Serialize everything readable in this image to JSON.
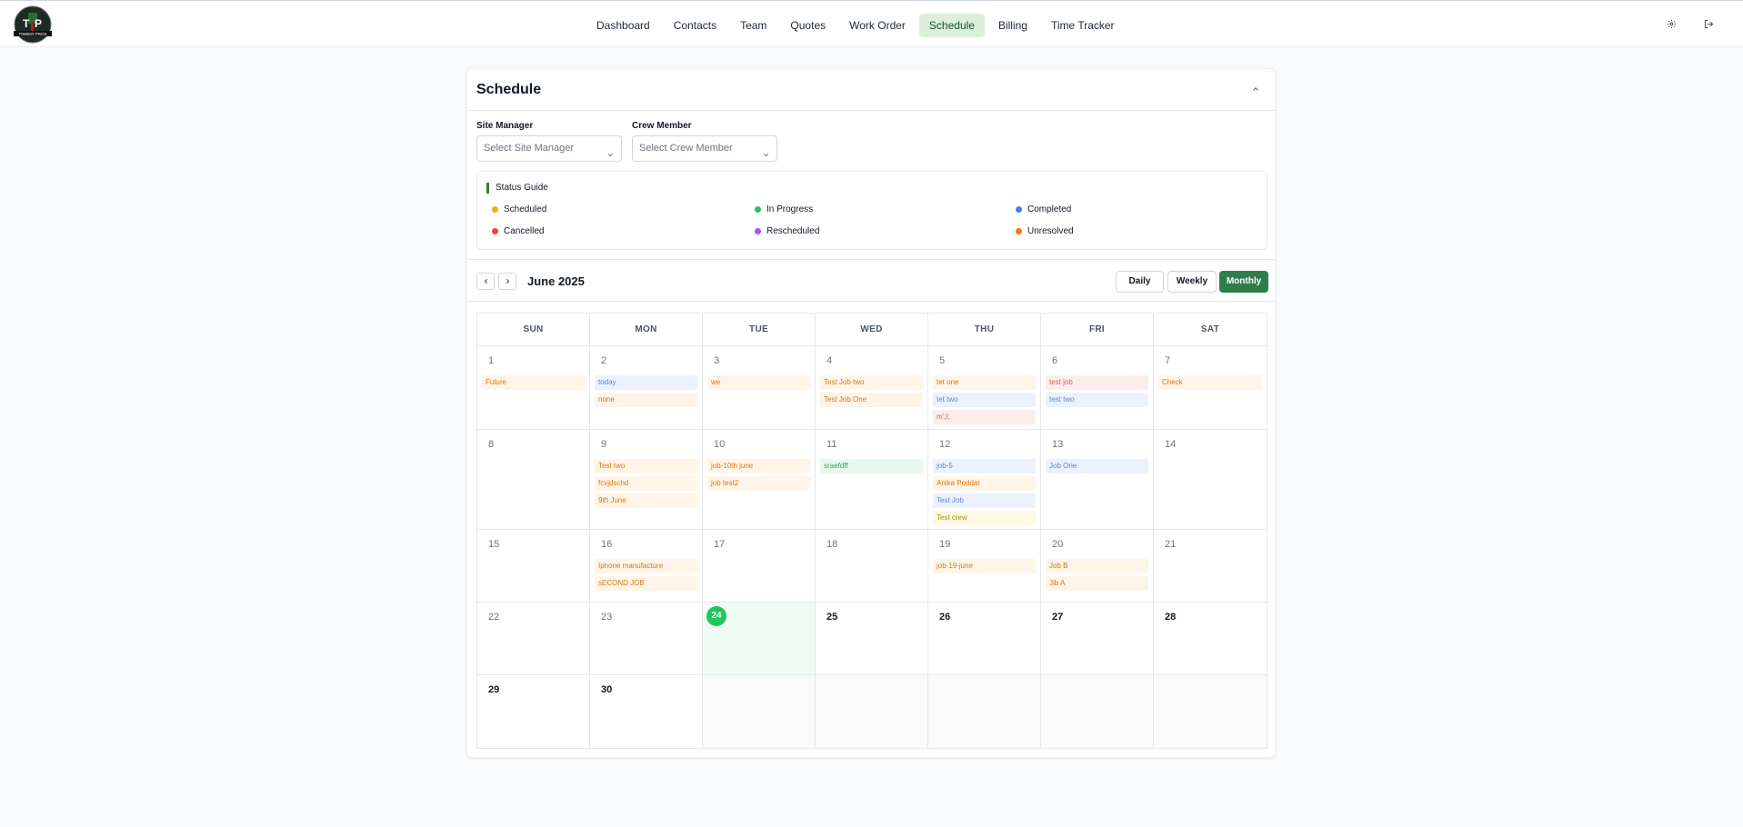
{
  "nav": {
    "logo_text": "TIMBER PROS",
    "items": [
      {
        "label": "Dashboard",
        "active": false
      },
      {
        "label": "Contacts",
        "active": false
      },
      {
        "label": "Team",
        "active": false
      },
      {
        "label": "Quotes",
        "active": false
      },
      {
        "label": "Work Order",
        "active": false
      },
      {
        "label": "Schedule",
        "active": true
      },
      {
        "label": "Billing",
        "active": false
      },
      {
        "label": "Time Tracker",
        "active": false
      }
    ],
    "settings_icon": "gear-icon",
    "logout_icon": "logout-icon"
  },
  "schedule": {
    "title": "Schedule",
    "filters": {
      "site_manager_label": "Site Manager",
      "site_manager_placeholder": "Select Site Manager",
      "crew_member_label": "Crew Member",
      "crew_member_placeholder": "Select Crew Member"
    },
    "status_guide": {
      "title": "Status Guide",
      "statuses": [
        {
          "label": "Scheduled",
          "color": "#eab308"
        },
        {
          "label": "In Progress",
          "color": "#22c55e"
        },
        {
          "label": "Completed",
          "color": "#3b82f6"
        },
        {
          "label": "Cancelled",
          "color": "#ef4444"
        },
        {
          "label": "Rescheduled",
          "color": "#a855f7"
        },
        {
          "label": "Unresolved",
          "color": "#f97316"
        }
      ]
    },
    "month_label": "June 2025",
    "views": {
      "daily": "Daily",
      "weekly": "Weekly",
      "monthly": "Monthly",
      "active": "Monthly"
    },
    "weekdays": [
      "SUN",
      "MON",
      "TUE",
      "WED",
      "THU",
      "FRI",
      "SAT"
    ],
    "today": 24,
    "weeks": [
      [
        {
          "day": "1",
          "events": [
            {
              "title": "Future",
              "color": "orange"
            }
          ]
        },
        {
          "day": "2",
          "events": [
            {
              "title": "today",
              "color": "blue"
            },
            {
              "title": "none",
              "color": "orange"
            }
          ]
        },
        {
          "day": "3",
          "events": [
            {
              "title": "we",
              "color": "orange"
            }
          ]
        },
        {
          "day": "4",
          "events": [
            {
              "title": "Test Job two",
              "color": "orange"
            },
            {
              "title": "Test Job One",
              "color": "orange"
            }
          ]
        },
        {
          "day": "5",
          "events": [
            {
              "title": "tet one",
              "color": "orange"
            },
            {
              "title": "tet two",
              "color": "blue"
            },
            {
              "title": "m';l;",
              "color": "red"
            }
          ]
        },
        {
          "day": "6",
          "events": [
            {
              "title": "test job",
              "color": "red"
            },
            {
              "title": "test two",
              "color": "blue"
            }
          ]
        },
        {
          "day": "7",
          "events": [
            {
              "title": "Check",
              "color": "orange"
            }
          ]
        }
      ],
      [
        {
          "day": "8",
          "events": []
        },
        {
          "day": "9",
          "events": [
            {
              "title": "Test two",
              "color": "orange"
            },
            {
              "title": "fcvjdschd",
              "color": "orange"
            },
            {
              "title": "9th June",
              "color": "orange"
            }
          ]
        },
        {
          "day": "10",
          "events": [
            {
              "title": "job-10th june",
              "color": "orange"
            },
            {
              "title": "job test2",
              "color": "orange"
            }
          ]
        },
        {
          "day": "11",
          "events": [
            {
              "title": "sraefdff",
              "color": "green"
            }
          ]
        },
        {
          "day": "12",
          "events": [
            {
              "title": "job-5",
              "color": "blue"
            },
            {
              "title": "Anika Poddar",
              "color": "orange"
            },
            {
              "title": "Test Job",
              "color": "blue"
            },
            {
              "title": "Test crew",
              "color": "yellow"
            }
          ]
        },
        {
          "day": "13",
          "events": [
            {
              "title": "Job One",
              "color": "blue"
            }
          ]
        },
        {
          "day": "14",
          "events": []
        }
      ],
      [
        {
          "day": "15",
          "events": []
        },
        {
          "day": "16",
          "events": [
            {
              "title": "Iphone manufacture",
              "color": "orange"
            },
            {
              "title": "sECOND JOB",
              "color": "orange"
            }
          ]
        },
        {
          "day": "17",
          "events": []
        },
        {
          "day": "18",
          "events": []
        },
        {
          "day": "19",
          "events": [
            {
              "title": "job-19-june",
              "color": "orange"
            }
          ]
        },
        {
          "day": "20",
          "events": [
            {
              "title": "Job B",
              "color": "orange"
            },
            {
              "title": "Jib A",
              "color": "orange"
            }
          ]
        },
        {
          "day": "21",
          "events": []
        }
      ],
      [
        {
          "day": "22",
          "events": []
        },
        {
          "day": "23",
          "events": []
        },
        {
          "day": "24",
          "events": []
        },
        {
          "day": "25",
          "events": []
        },
        {
          "day": "26",
          "events": []
        },
        {
          "day": "27",
          "events": []
        },
        {
          "day": "28",
          "events": []
        }
      ],
      [
        {
          "day": "29",
          "events": []
        },
        {
          "day": "30",
          "events": []
        },
        {
          "day": "",
          "events": []
        },
        {
          "day": "",
          "events": []
        },
        {
          "day": "",
          "events": []
        },
        {
          "day": "",
          "events": []
        },
        {
          "day": "",
          "events": []
        }
      ]
    ]
  }
}
